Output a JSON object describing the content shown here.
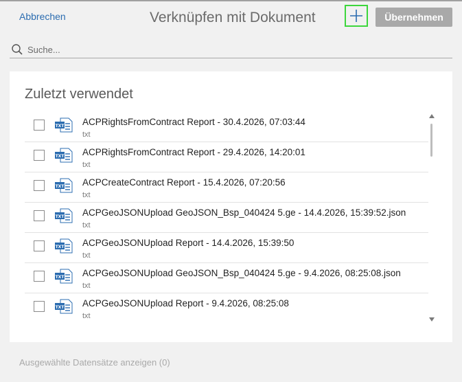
{
  "header": {
    "cancel_label": "Abbrechen",
    "title": "Verknüpfen mit Dokument",
    "add_icon": "plus-icon",
    "apply_label": "Übernehmen"
  },
  "search": {
    "placeholder": "Suche...",
    "value": ""
  },
  "recent": {
    "title": "Zuletzt verwendet",
    "items": [
      {
        "title": "ACPRightsFromContract Report - 30.4.2026, 07:03:44",
        "type": "txt",
        "icon": "txt-file-icon"
      },
      {
        "title": "ACPRightsFromContract Report - 29.4.2026, 14:20:01",
        "type": "txt",
        "icon": "txt-file-icon"
      },
      {
        "title": "ACPCreateContract Report - 15.4.2026, 07:20:56",
        "type": "txt",
        "icon": "txt-file-icon"
      },
      {
        "title": "ACPGeoJSONUpload GeoJSON_Bsp_040424 5.ge - 14.4.2026, 15:39:52.json",
        "type": "txt",
        "icon": "txt-file-icon"
      },
      {
        "title": "ACPGeoJSONUpload Report - 14.4.2026, 15:39:50",
        "type": "txt",
        "icon": "txt-file-icon"
      },
      {
        "title": "ACPGeoJSONUpload GeoJSON_Bsp_040424 5.ge - 9.4.2026, 08:25:08.json",
        "type": "txt",
        "icon": "txt-file-icon"
      },
      {
        "title": "ACPGeoJSONUpload Report - 9.4.2026, 08:25:08",
        "type": "txt",
        "icon": "txt-file-icon"
      }
    ]
  },
  "footer": {
    "show_selected_label": "Ausgewählte Datensätze anzeigen (0)"
  },
  "colors": {
    "accent": "#2b6cb0",
    "add_button_border": "#3cd63c",
    "apply_button_bg": "#a9a9a9",
    "file_icon": "#2b6cb0"
  }
}
